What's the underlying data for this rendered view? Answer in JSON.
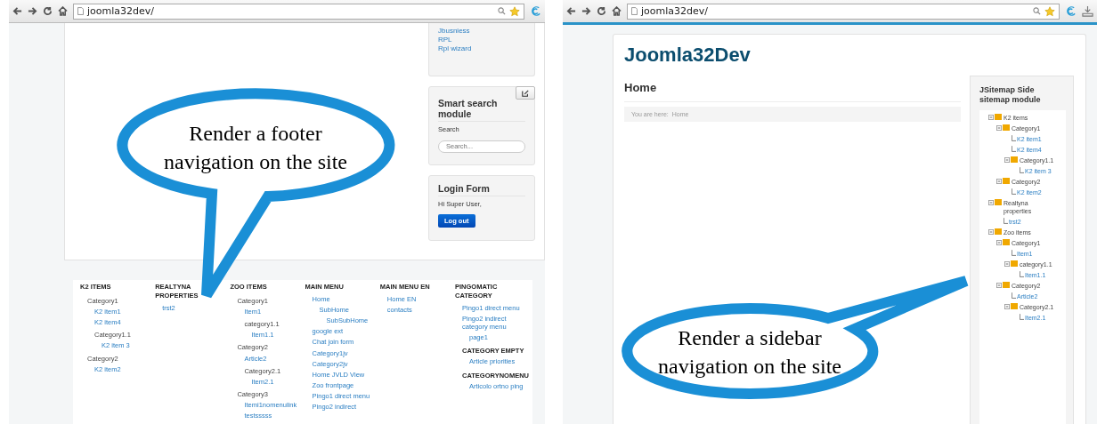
{
  "left": {
    "browser": {
      "url": "joomla32dev/"
    },
    "sidebar": {
      "links": [
        "Jbusniess",
        "RPL",
        "Rpl wizard"
      ],
      "search_module": {
        "title": "Smart search module",
        "label": "Search",
        "placeholder": "Search..."
      },
      "login_module": {
        "title": "Login Form",
        "greeting": "Hi Super User,",
        "button": "Log out"
      }
    },
    "footer": {
      "columns": [
        {
          "title": "K2 ITEMS",
          "items": [
            {
              "label": "Category1",
              "kind": "category",
              "children": [
                {
                  "label": "K2 item1",
                  "kind": "link"
                },
                {
                  "label": "K2 item4",
                  "kind": "link"
                },
                {
                  "label": "Category1.1",
                  "kind": "category",
                  "children": [
                    {
                      "label": "K2 item 3",
                      "kind": "link"
                    }
                  ]
                }
              ]
            },
            {
              "label": "Category2",
              "kind": "category",
              "children": [
                {
                  "label": "K2 item2",
                  "kind": "link"
                }
              ]
            }
          ]
        },
        {
          "title": "REALTYNA PROPERTIES",
          "items": [
            {
              "label": "trst2",
              "kind": "link"
            }
          ]
        },
        {
          "title": "ZOO ITEMS",
          "items": [
            {
              "label": "Category1",
              "kind": "category",
              "children": [
                {
                  "label": "Item1",
                  "kind": "link"
                },
                {
                  "label": "category1.1",
                  "kind": "category",
                  "children": [
                    {
                      "label": "Item1.1",
                      "kind": "link"
                    }
                  ]
                }
              ]
            },
            {
              "label": "Category2",
              "kind": "category",
              "children": [
                {
                  "label": "Article2",
                  "kind": "link"
                },
                {
                  "label": "Category2.1",
                  "kind": "category",
                  "children": [
                    {
                      "label": "Item2.1",
                      "kind": "link"
                    }
                  ]
                }
              ]
            },
            {
              "label": "Category3",
              "kind": "category",
              "children": [
                {
                  "label": "Itemi1nomenulink",
                  "kind": "link"
                },
                {
                  "label": "testsssss",
                  "kind": "link"
                }
              ]
            }
          ]
        },
        {
          "title": "MAIN MENU",
          "items": [
            {
              "label": "Home",
              "kind": "link",
              "children": [
                {
                  "label": "SubHome",
                  "kind": "link",
                  "children": [
                    {
                      "label": "SubSubHome",
                      "kind": "link"
                    }
                  ]
                }
              ]
            },
            {
              "label": "google ext",
              "kind": "link"
            },
            {
              "label": "Chat join form",
              "kind": "link"
            },
            {
              "label": "Category1jv",
              "kind": "link"
            },
            {
              "label": "Category2jv",
              "kind": "link"
            },
            {
              "label": "Home JVLD View",
              "kind": "link"
            },
            {
              "label": "Zoo frontpage",
              "kind": "link"
            },
            {
              "label": "Pingo1 direct menu",
              "kind": "link"
            },
            {
              "label": "Pingo2 indirect",
              "kind": "link"
            }
          ]
        },
        {
          "title": "MAIN MENU EN",
          "items": [
            {
              "label": "Home EN",
              "kind": "link"
            },
            {
              "label": "contacts",
              "kind": "link"
            }
          ]
        },
        {
          "title": "PINGOMATIC CATEGORY",
          "items": [
            {
              "label": "Pingo1 direct menu",
              "kind": "link"
            },
            {
              "label": "Pingo2 indirect category menu",
              "kind": "link",
              "children": [
                {
                  "label": "page1",
                  "kind": "link"
                }
              ]
            },
            {
              "label": "CATEGORY EMPTY",
              "kind": "heading",
              "children": [
                {
                  "label": "Article priorities",
                  "kind": "link"
                }
              ]
            },
            {
              "label": "CATEGORYNOMENU",
              "kind": "heading",
              "children": [
                {
                  "label": "Articolo ortno ping",
                  "kind": "link"
                }
              ]
            }
          ]
        }
      ]
    },
    "callout": [
      "Render a footer",
      "navigation on the site"
    ]
  },
  "right": {
    "browser": {
      "url": "joomla32dev/"
    },
    "site_title": "Joomla32Dev",
    "page_title": "Home",
    "breadcrumb": {
      "label": "You are here:",
      "current": "Home"
    },
    "sitemap": {
      "title": "JSitemap Side sitemap module",
      "tree": [
        {
          "label": "K2 items",
          "kind": "folder",
          "children": [
            {
              "label": "Category1",
              "kind": "folder",
              "children": [
                {
                  "label": "K2 item1",
                  "kind": "link"
                },
                {
                  "label": "K2 item4",
                  "kind": "link"
                },
                {
                  "label": "Category1.1",
                  "kind": "folder",
                  "children": [
                    {
                      "label": "K2 item 3",
                      "kind": "link"
                    }
                  ]
                }
              ]
            },
            {
              "label": "Category2",
              "kind": "folder",
              "children": [
                {
                  "label": "K2 item2",
                  "kind": "link"
                }
              ]
            }
          ]
        },
        {
          "label": "Realtyna properties",
          "kind": "folder",
          "children": [
            {
              "label": "trst2",
              "kind": "link"
            }
          ]
        },
        {
          "label": "Zoo items",
          "kind": "folder",
          "children": [
            {
              "label": "Category1",
              "kind": "folder",
              "children": [
                {
                  "label": "Item1",
                  "kind": "link"
                },
                {
                  "label": "category1.1",
                  "kind": "folder",
                  "children": [
                    {
                      "label": "Item1.1",
                      "kind": "link"
                    }
                  ]
                }
              ]
            },
            {
              "label": "Category2",
              "kind": "folder",
              "children": [
                {
                  "label": "Article2",
                  "kind": "link"
                },
                {
                  "label": "Category2.1",
                  "kind": "folder",
                  "children": [
                    {
                      "label": "Item2.1",
                      "kind": "link"
                    }
                  ]
                }
              ]
            }
          ]
        }
      ]
    },
    "callout": [
      "Render a sidebar",
      "navigation on the site"
    ]
  }
}
